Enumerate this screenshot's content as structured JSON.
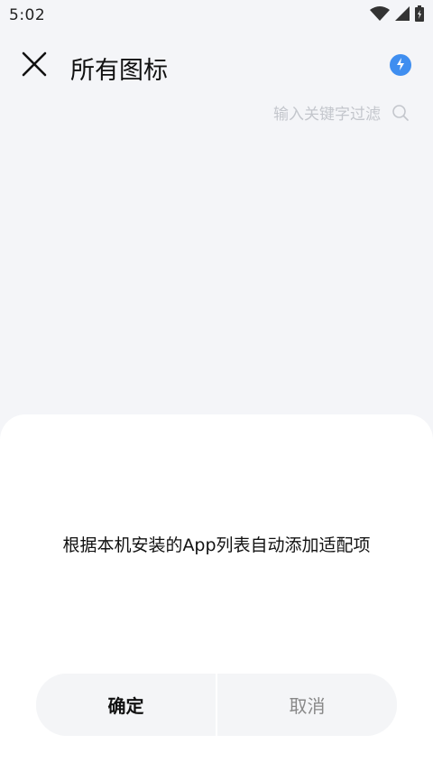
{
  "status_bar": {
    "time": "5:02"
  },
  "header": {
    "title": "所有图标"
  },
  "search": {
    "placeholder": "输入关键字过滤"
  },
  "dialog": {
    "message": "根据本机安装的App列表自动添加适配项",
    "confirm_label": "确定",
    "cancel_label": "取消"
  },
  "colors": {
    "accent": "#3f8ef0",
    "background": "#f4f5f8",
    "sheet": "#ffffff"
  }
}
